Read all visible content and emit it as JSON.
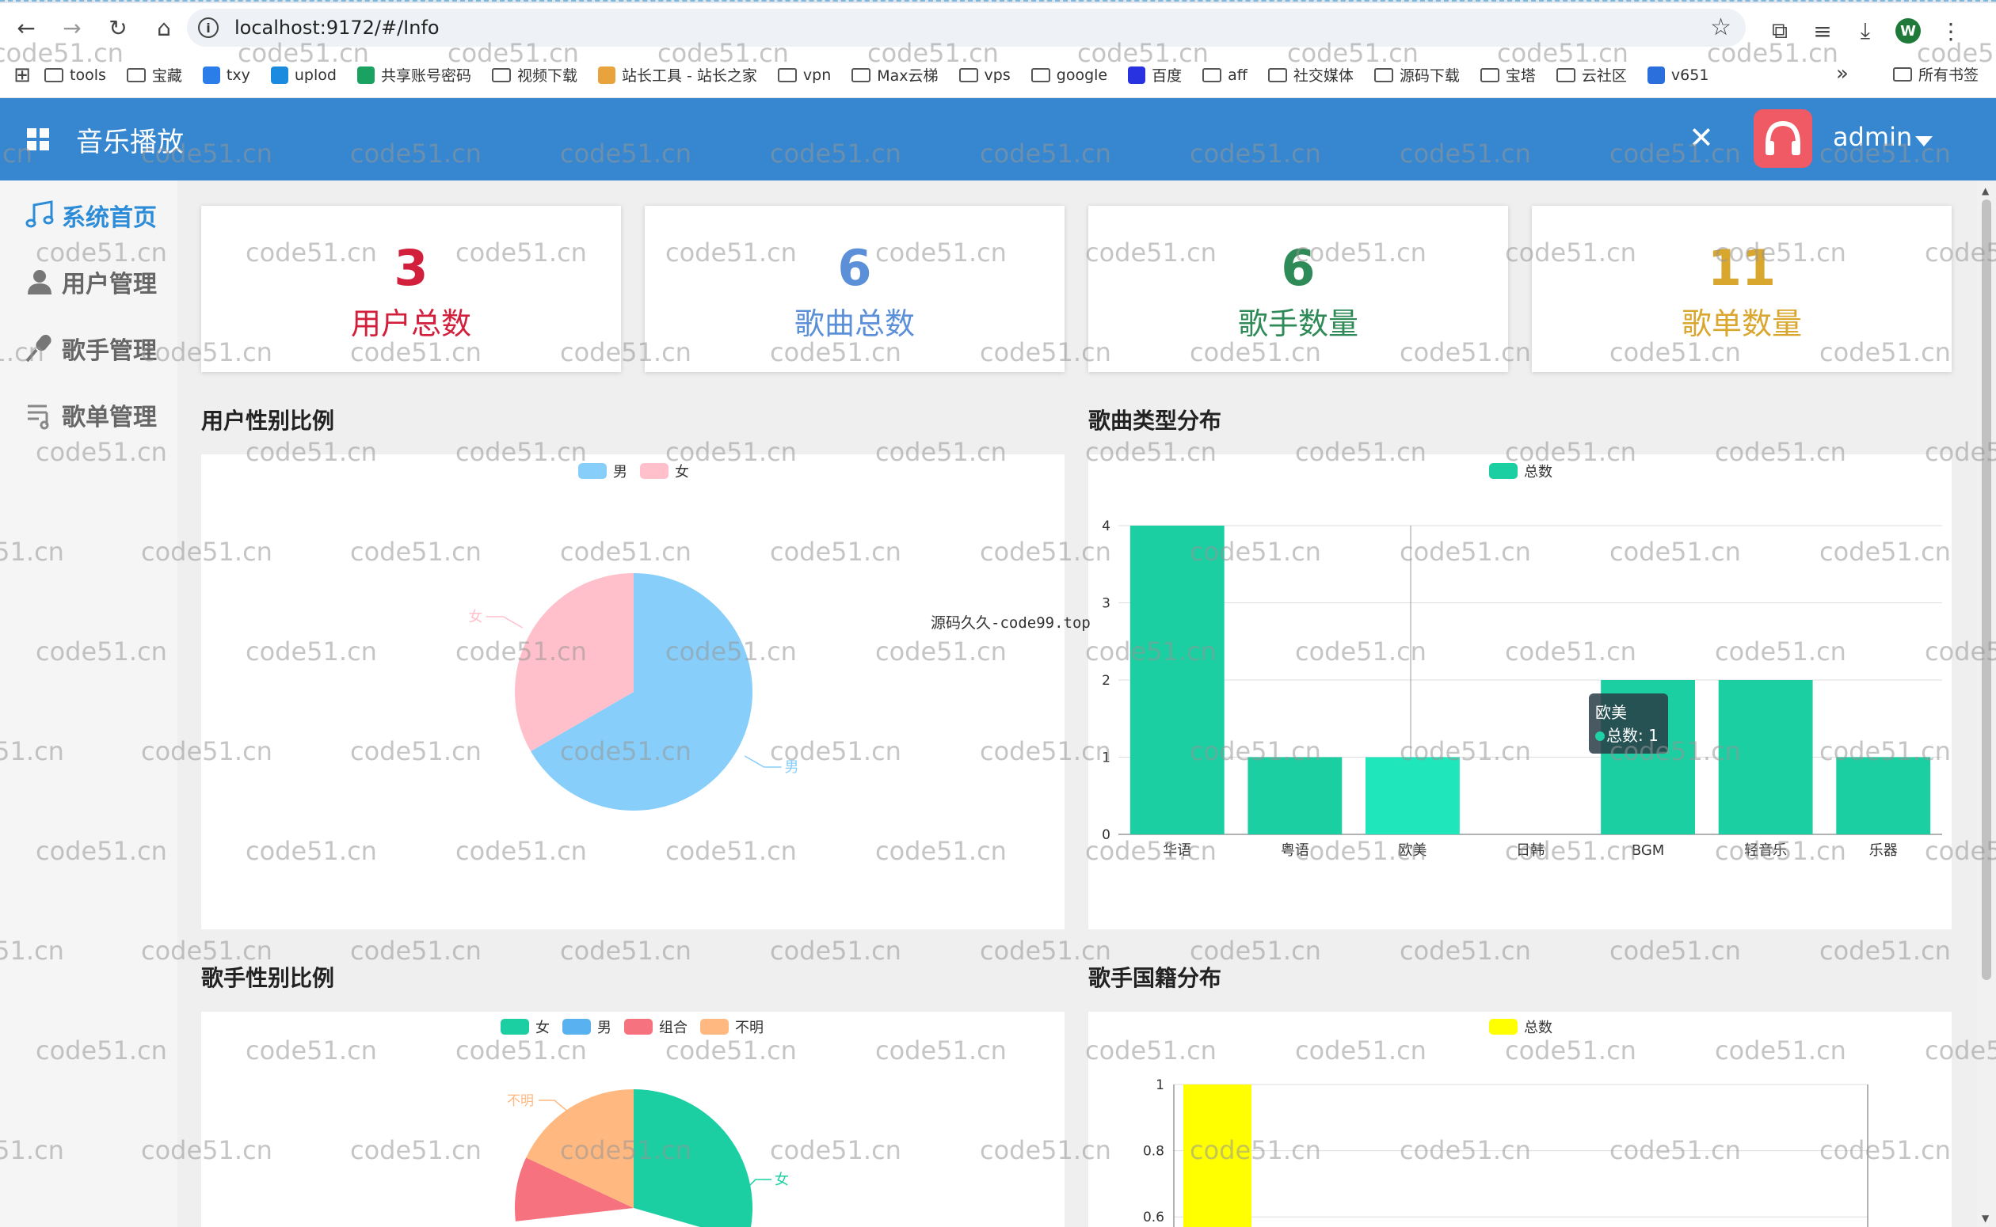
{
  "browser": {
    "url": "localhost:9172/#/Info",
    "profile_initial": "W",
    "icons": [
      "back-icon",
      "forward-icon",
      "reload-icon",
      "home-icon",
      "info-icon",
      "star-icon",
      "extensions-icon",
      "media-icon",
      "download-icon",
      "menu-icon"
    ]
  },
  "bookmarks": {
    "items": [
      {
        "label": "tools",
        "icon": "folder"
      },
      {
        "label": "宝藏",
        "icon": "folder"
      },
      {
        "label": "txy",
        "icon": "cloud"
      },
      {
        "label": "uplod",
        "icon": "upload"
      },
      {
        "label": "共享账号密码",
        "icon": "sheet"
      },
      {
        "label": "视频下载",
        "icon": "folder"
      },
      {
        "label": "站长工具 - 站长之家",
        "icon": "site"
      },
      {
        "label": "vpn",
        "icon": "folder"
      },
      {
        "label": "Max云梯",
        "icon": "folder"
      },
      {
        "label": "vps",
        "icon": "folder"
      },
      {
        "label": "google",
        "icon": "folder"
      },
      {
        "label": "百度",
        "icon": "baidu"
      },
      {
        "label": "aff",
        "icon": "folder"
      },
      {
        "label": "社交媒体",
        "icon": "folder"
      },
      {
        "label": "源码下载",
        "icon": "folder"
      },
      {
        "label": "宝塔",
        "icon": "folder"
      },
      {
        "label": "云社区",
        "icon": "folder"
      },
      {
        "label": "v651",
        "icon": "v"
      }
    ],
    "more": "»",
    "all_label": "所有书签"
  },
  "header": {
    "title": "音乐播放",
    "user": "admin",
    "accent": "#3687cf"
  },
  "sidebar": {
    "items": [
      {
        "label": "系统首页",
        "icon": "music-note-icon",
        "active": true
      },
      {
        "label": "用户管理",
        "icon": "user-icon",
        "active": false
      },
      {
        "label": "歌手管理",
        "icon": "microphone-icon",
        "active": false
      },
      {
        "label": "歌单管理",
        "icon": "playlist-icon",
        "active": false
      }
    ]
  },
  "stats": [
    {
      "value": "3",
      "label": "用户总数",
      "color": "#d21f3c"
    },
    {
      "value": "6",
      "label": "歌曲总数",
      "color": "#5b8fd8"
    },
    {
      "value": "6",
      "label": "歌手数量",
      "color": "#2e8a57"
    },
    {
      "value": "11",
      "label": "歌单数量",
      "color": "#d9a62e"
    }
  ],
  "sections": {
    "user_gender": "用户性别比例",
    "song_types": "歌曲类型分布",
    "singer_gender": "歌手性别比例",
    "singer_country": "歌手国籍分布"
  },
  "overlay_text": "源码久久-code99.top",
  "watermark": "code51.cn",
  "tooltip": {
    "title": "欧美",
    "text": "总数: 1"
  },
  "chart_data": [
    {
      "type": "pie",
      "legend": [
        "男",
        "女"
      ],
      "labels": [
        "男",
        "女"
      ],
      "values": [
        2,
        1
      ],
      "colors": [
        "#87cefa",
        "#ffc0cb"
      ]
    },
    {
      "type": "bar",
      "legend": [
        "总数"
      ],
      "categories": [
        "华语",
        "粤语",
        "欧美",
        "日韩",
        "BGM",
        "轻音乐",
        "乐器"
      ],
      "series": [
        {
          "name": "总数",
          "values": [
            4,
            1,
            1,
            0,
            2,
            2,
            1
          ]
        }
      ],
      "ylim": [
        0,
        4
      ],
      "yticks": [
        "0",
        "1",
        "2",
        "3",
        "4"
      ],
      "color": "#1bcfa2",
      "highlight_color": "#1fe6bb"
    },
    {
      "type": "pie",
      "legend": [
        "女",
        "男",
        "组合",
        "不明"
      ],
      "visible_labels": [
        "女",
        "不明"
      ],
      "colors": [
        "#1bcfa2",
        "#5ab1ef",
        "#f5727e",
        "#ffb980"
      ]
    },
    {
      "type": "bar",
      "legend": [
        "总数"
      ],
      "yticks": [
        "0.6",
        "0.8",
        "1"
      ],
      "ylim": [
        0,
        1
      ],
      "visible_values": [
        1
      ],
      "color": "#ffff00"
    }
  ]
}
